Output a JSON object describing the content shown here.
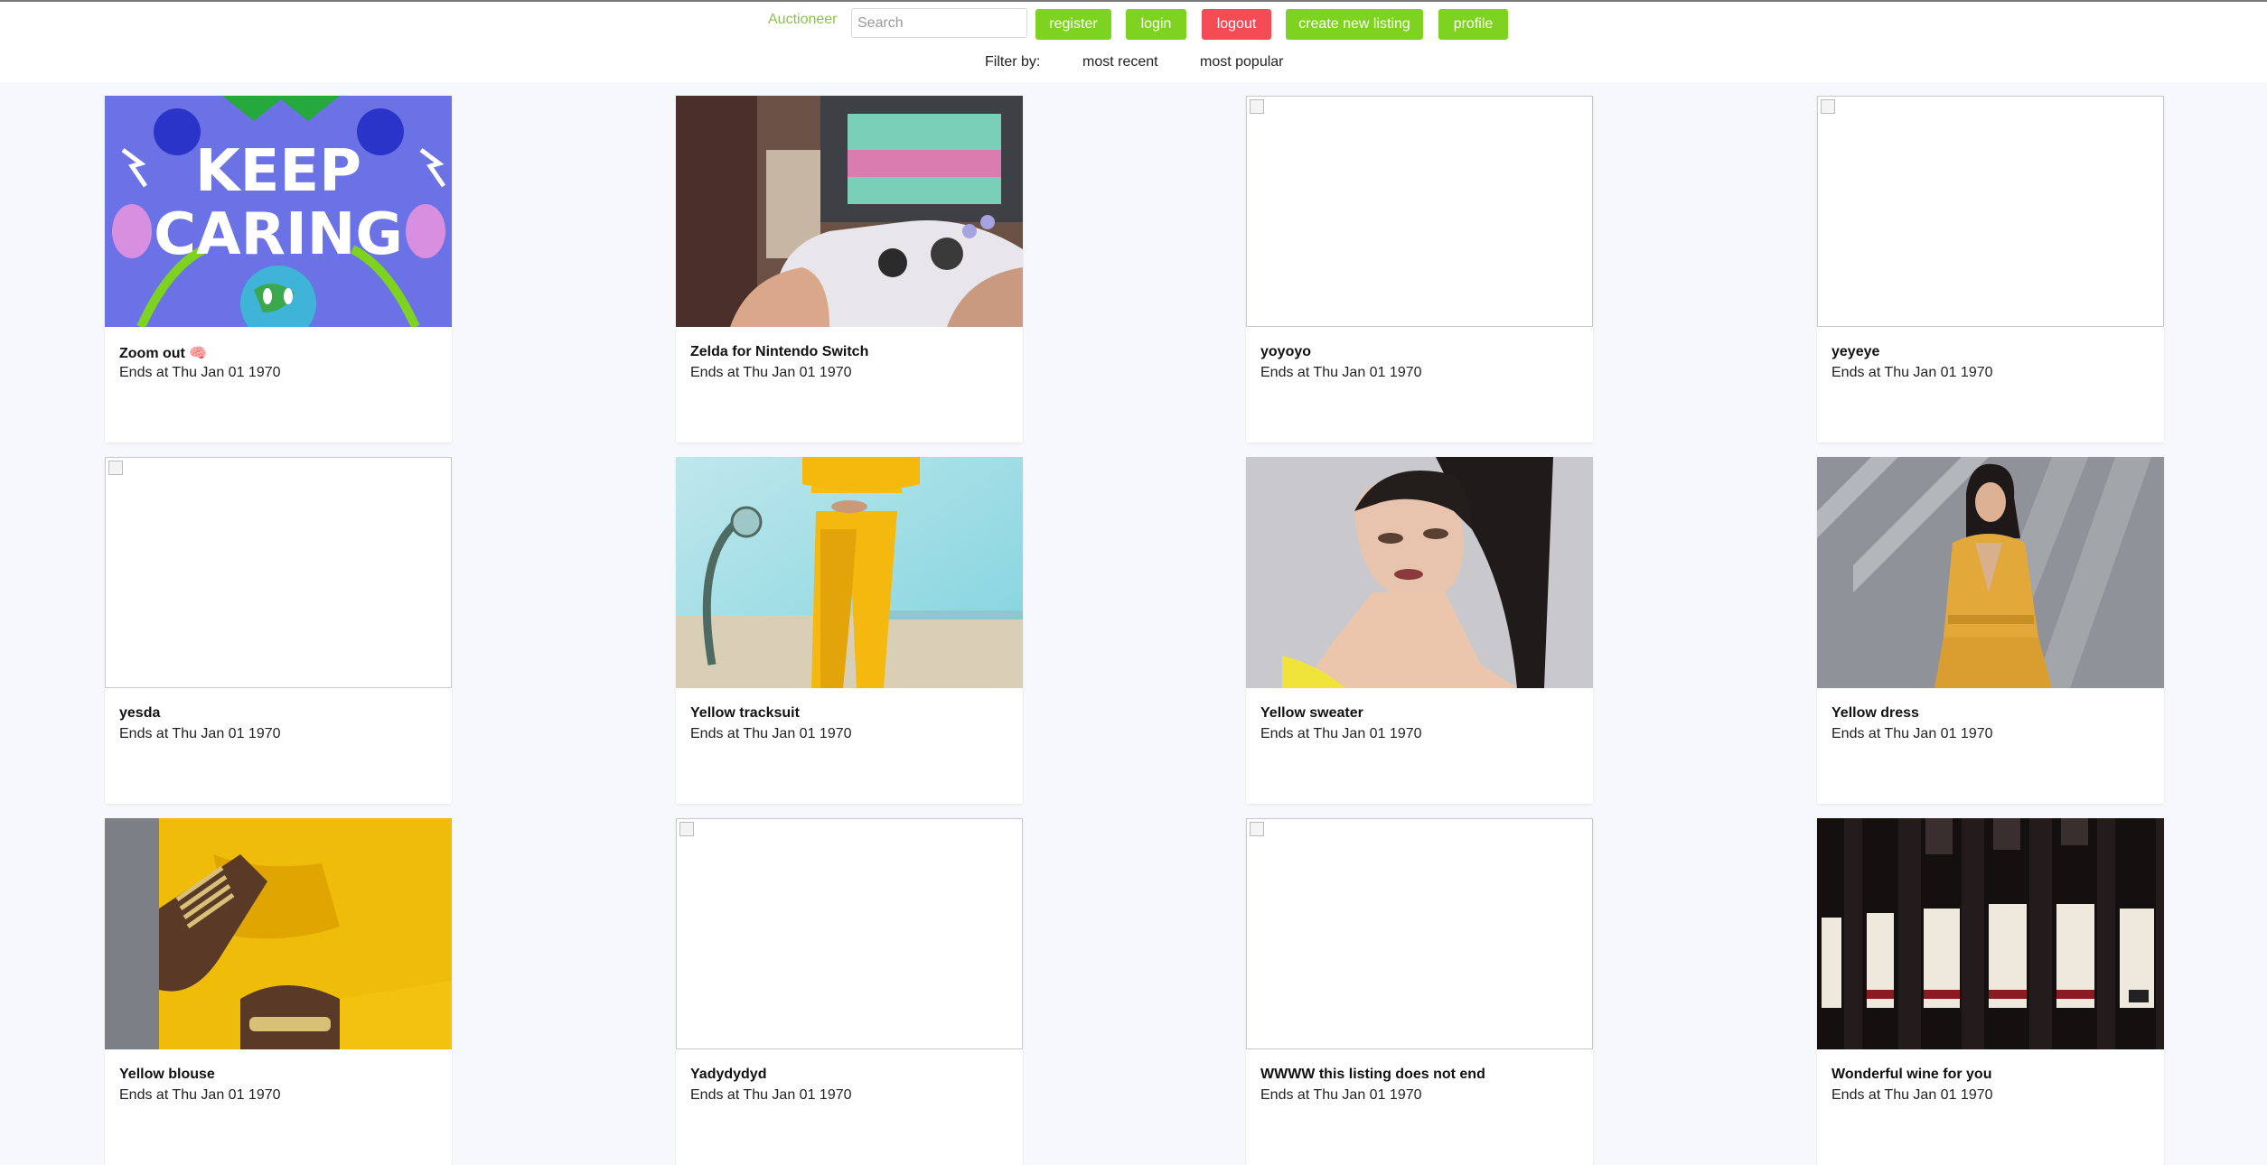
{
  "header": {
    "brand": "Auctioneer",
    "search_placeholder": "Search",
    "nav": {
      "register": "register",
      "login": "login",
      "logout": "logout",
      "create": "create new listing",
      "profile": "profile"
    },
    "filter_label": "Filter by:",
    "filter_recent": "most recent",
    "filter_popular": "most popular"
  },
  "colors": {
    "accent_green": "#7ed321",
    "logout_red": "#f44b55",
    "brand_green": "#8bc34a",
    "page_bg": "#f6f8fb"
  },
  "listings": [
    {
      "title": "Zoom out 🧠",
      "ends": "Ends at Thu Jan 01 1970",
      "image": "keep-caring-illustration"
    },
    {
      "title": "Zelda for Nintendo Switch",
      "ends": "Ends at Thu Jan 01 1970",
      "image": "game-controller-photo"
    },
    {
      "title": "yoyoyo",
      "ends": "Ends at Thu Jan 01 1970",
      "image": "broken-image"
    },
    {
      "title": "yeyeye",
      "ends": "Ends at Thu Jan 01 1970",
      "image": "broken-image"
    },
    {
      "title": "yesda",
      "ends": "Ends at Thu Jan 01 1970",
      "image": "broken-image"
    },
    {
      "title": "Yellow tracksuit",
      "ends": "Ends at Thu Jan 01 1970",
      "image": "yellow-tracksuit-photo"
    },
    {
      "title": "Yellow sweater",
      "ends": "Ends at Thu Jan 01 1970",
      "image": "yellow-sweater-photo"
    },
    {
      "title": "Yellow dress",
      "ends": "Ends at Thu Jan 01 1970",
      "image": "yellow-dress-photo"
    },
    {
      "title": "Yellow blouse",
      "ends": "Ends at Thu Jan 01 1970",
      "image": "yellow-blouse-photo"
    },
    {
      "title": "Yadydydyd",
      "ends": "Ends at Thu Jan 01 1970",
      "image": "broken-image"
    },
    {
      "title": "WWWW this listing does not end",
      "ends": "Ends at Thu Jan 01 1970",
      "image": "broken-image"
    },
    {
      "title": "Wonderful wine for you",
      "ends": "Ends at Thu Jan 01 1970",
      "image": "wine-bottles-photo"
    }
  ]
}
